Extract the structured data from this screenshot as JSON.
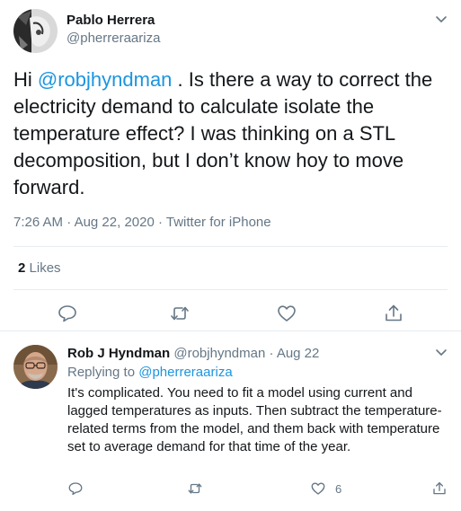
{
  "main_tweet": {
    "author_name": "Pablo Herrera",
    "author_handle": "@pherreraariza",
    "text_prefix": "Hi ",
    "mention": "@robjhyndman",
    "text_rest": " . Is there a way to correct the electricity demand to calculate isolate the temperature effect? I was thinking on a STL decomposition, but I don’t know hoy to move forward.",
    "time": "7:26 AM",
    "date": "Aug 22, 2020",
    "source": "Twitter for iPhone",
    "separator": " · ",
    "likes_count": "2",
    "likes_label": "Likes",
    "icons": [
      "reply-icon",
      "retweet-icon",
      "like-icon",
      "share-icon",
      "chevron-down-icon"
    ]
  },
  "reply_tweet": {
    "author_name": "Rob J Hyndman",
    "author_handle": "@robjhyndman",
    "separator": " · ",
    "date": "Aug 22",
    "replying_to_label": "Replying to ",
    "replying_to_handle": "@pherreraariza",
    "text": "It's complicated. You need to fit a model using current and lagged temperatures as inputs. Then subtract the temperature-related terms from the model, and them back with temperature set to average demand for that time of the year.",
    "like_count": "6",
    "icons": [
      "reply-icon",
      "retweet-icon",
      "like-icon",
      "share-icon",
      "chevron-down-icon"
    ]
  },
  "colors": {
    "text": "#14171a",
    "secondary": "#657786",
    "link": "#1b95e0",
    "divider": "#e6ecf0"
  }
}
